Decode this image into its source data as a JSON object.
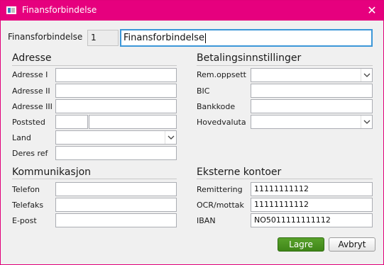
{
  "window": {
    "title": "Finansforbindelse",
    "close_glyph": "✕",
    "accent_color": "#e6007e"
  },
  "top": {
    "label": "Finansforbindelse",
    "id_value": "1",
    "name_value": "Finansforbindelse"
  },
  "adresse": {
    "heading": "Adresse",
    "labels": {
      "adresse1": "Adresse I",
      "adresse2": "Adresse II",
      "adresse3": "Adresse III",
      "poststed": "Poststed",
      "land": "Land",
      "deres_ref": "Deres ref"
    },
    "values": {
      "adresse1": "",
      "adresse2": "",
      "adresse3": "",
      "postnr": "",
      "poststed": "",
      "land": "",
      "deres_ref": ""
    }
  },
  "kommunikasjon": {
    "heading": "Kommunikasjon",
    "labels": {
      "telefon": "Telefon",
      "telefaks": "Telefaks",
      "epost": "E-post"
    },
    "values": {
      "telefon": "",
      "telefaks": "",
      "epost": ""
    }
  },
  "betaling": {
    "heading": "Betalingsinnstillinger",
    "labels": {
      "rem_oppsett": "Rem.oppsett",
      "bic": "BIC",
      "bankkode": "Bankkode",
      "hovedvaluta": "Hovedvaluta"
    },
    "values": {
      "rem_oppsett": "",
      "bic": "",
      "bankkode": "",
      "hovedvaluta": ""
    }
  },
  "kontoer": {
    "heading": "Eksterne kontoer",
    "labels": {
      "remittering": "Remittering",
      "ocr": "OCR/mottak",
      "iban": "IBAN"
    },
    "values": {
      "remittering": "11111111112",
      "ocr": "11111111112",
      "iban": "NO5011111111112"
    }
  },
  "buttons": {
    "save": "Lagre",
    "cancel": "Avbryt",
    "save_color": "#4a9a22"
  },
  "icons": {
    "app": "window-app-icon",
    "close": "close-icon",
    "dropdown": "chevron-down-icon"
  }
}
